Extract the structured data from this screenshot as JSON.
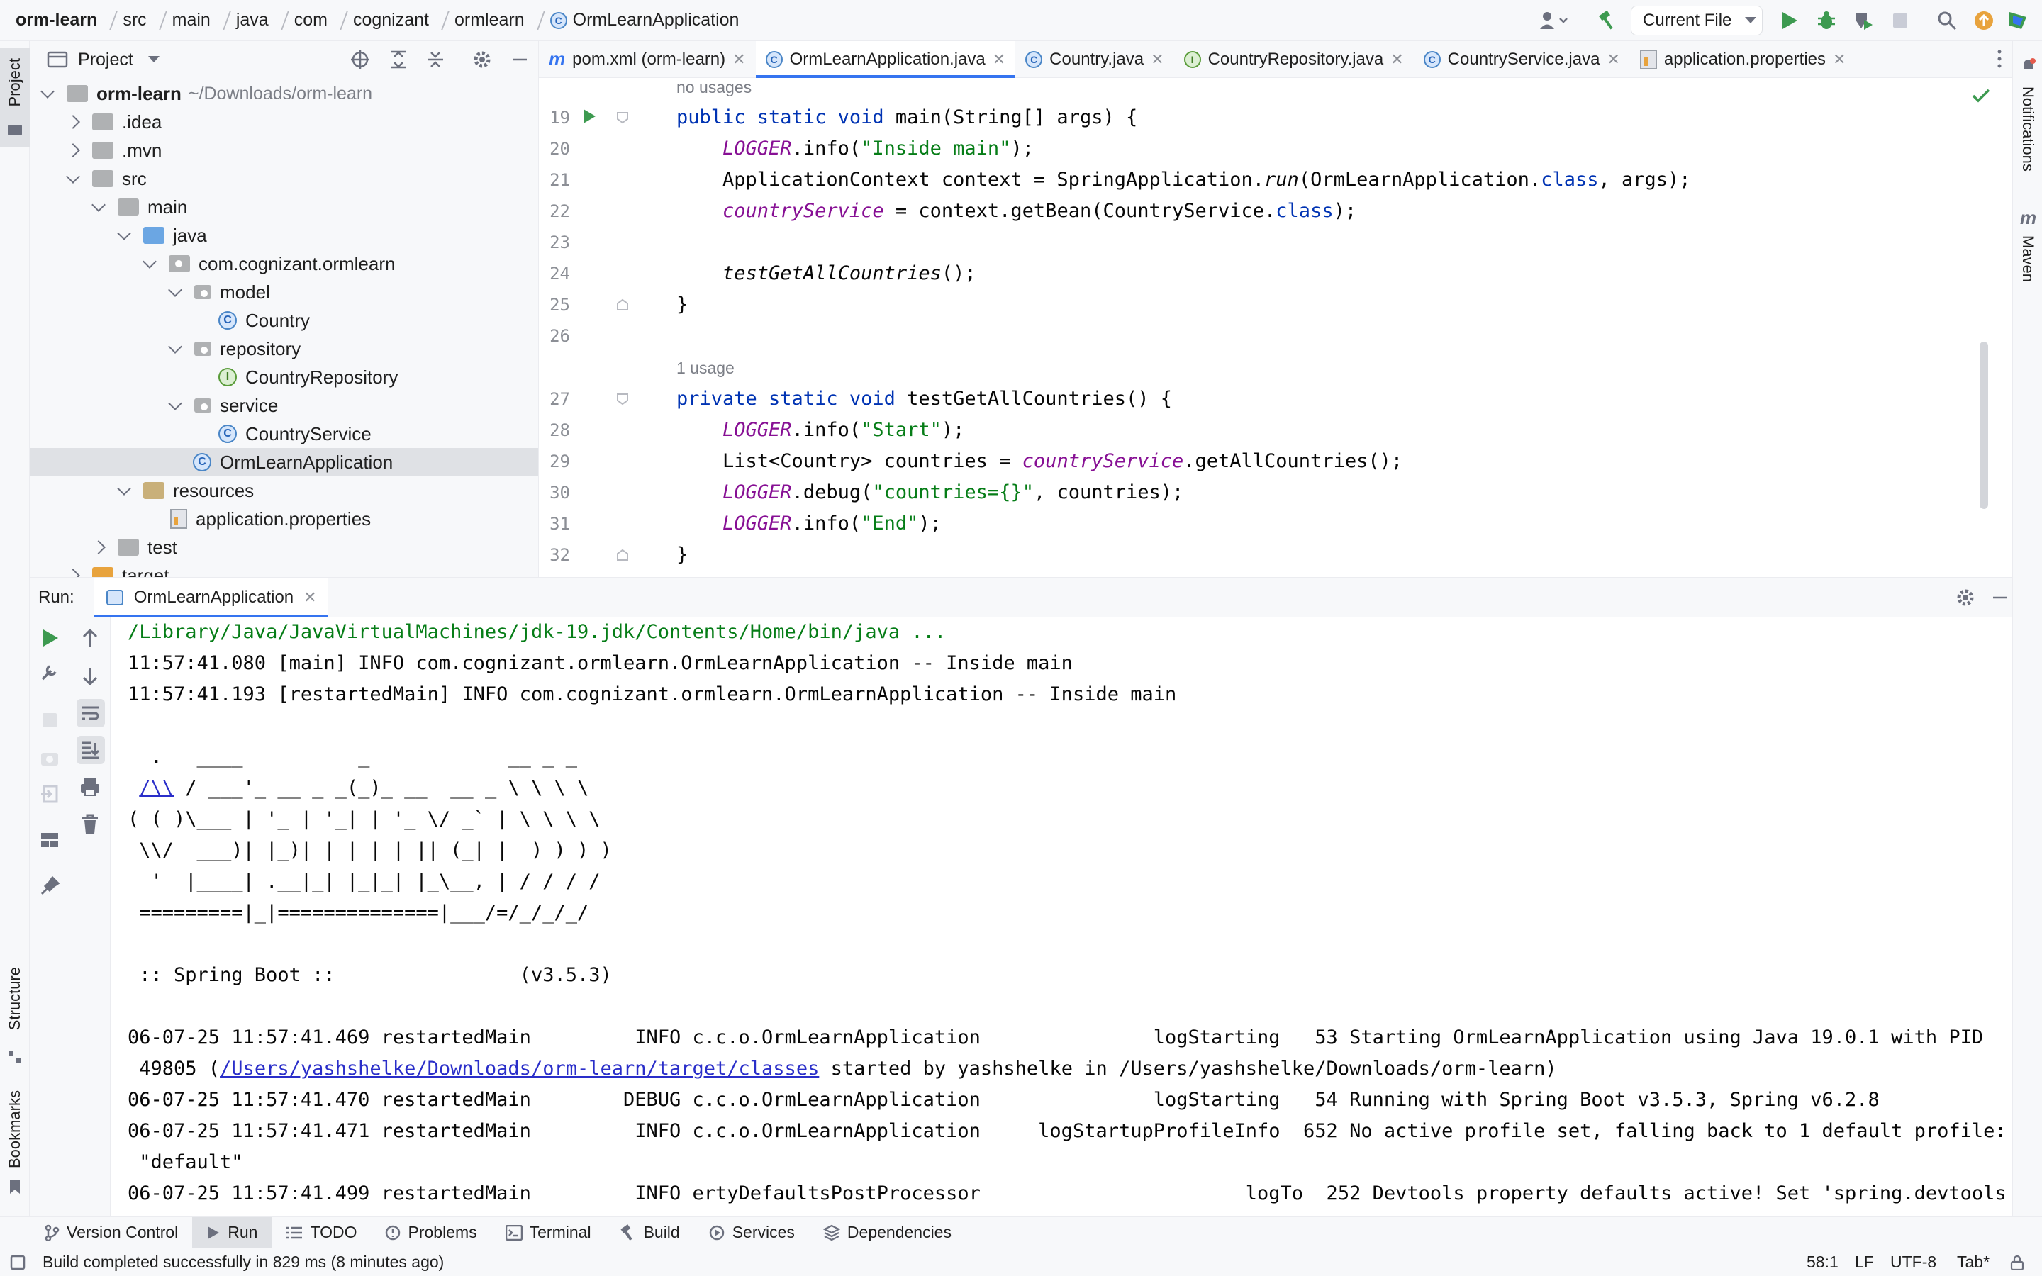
{
  "breadcrumb": [
    "orm-learn",
    "src",
    "main",
    "java",
    "com",
    "cognizant",
    "ormlearn",
    "OrmLearnApplication"
  ],
  "toolbar": {
    "run_config": "Current File"
  },
  "left_strip": {
    "project": "Project",
    "structure": "Structure",
    "bookmarks": "Bookmarks"
  },
  "right_strip": {
    "notifications": "Notifications",
    "maven": "Maven"
  },
  "project_panel": {
    "title": "Project",
    "tree": [
      {
        "label": "orm-learn",
        "path": "~/Downloads/orm-learn"
      },
      {
        "label": ".idea"
      },
      {
        "label": ".mvn"
      },
      {
        "label": "src"
      },
      {
        "label": "main"
      },
      {
        "label": "java"
      },
      {
        "label": "com.cognizant.ormlearn"
      },
      {
        "label": "model"
      },
      {
        "label": "Country"
      },
      {
        "label": "repository"
      },
      {
        "label": "CountryRepository"
      },
      {
        "label": "service"
      },
      {
        "label": "CountryService"
      },
      {
        "label": "OrmLearnApplication"
      },
      {
        "label": "resources"
      },
      {
        "label": "application.properties"
      },
      {
        "label": "test"
      },
      {
        "label": "target"
      }
    ]
  },
  "tabs": [
    {
      "label": "pom.xml (orm-learn)",
      "icon": "m"
    },
    {
      "label": "OrmLearnApplication.java",
      "icon": "C"
    },
    {
      "label": "Country.java",
      "icon": "C"
    },
    {
      "label": "CountryRepository.java",
      "icon": "I"
    },
    {
      "label": "CountryService.java",
      "icon": "C"
    },
    {
      "label": "application.properties",
      "icon": "props"
    }
  ],
  "editor": {
    "hints": {
      "no_usages": "no usages",
      "one_usage": "1 usage"
    },
    "line_numbers": [
      "19",
      "20",
      "21",
      "22",
      "23",
      "24",
      "25",
      "26",
      "27",
      "28",
      "29",
      "30",
      "31",
      "32"
    ],
    "code": {
      "l19a": "public static void ",
      "l19b": "main(String[] args) {",
      "l20a": "    ",
      "l20b": "LOGGER",
      "l20c": ".info(",
      "l20d": "\"Inside main\"",
      "l20e": ");",
      "l21a": "    ApplicationContext context = SpringApplication.",
      "l21b": "run",
      "l21c": "(OrmLearnApplication.",
      "l21d": "class",
      "l21e": ", args);",
      "l22a": "    ",
      "l22b": "countryService",
      "l22c": " = context.getBean(CountryService.",
      "l22d": "class",
      "l22e": ");",
      "l24a": "    ",
      "l24b": "testGetAllCountries",
      "l24c": "();",
      "l25": "}",
      "l27a": "private static void ",
      "l27b": "testGetAllCountries() {",
      "l28a": "    ",
      "l28b": "LOGGER",
      "l28c": ".info(",
      "l28d": "\"Start\"",
      "l28e": ");",
      "l29a": "    List<Country> countries = ",
      "l29b": "countryService",
      "l29c": ".getAllCountries();",
      "l30a": "    ",
      "l30b": "LOGGER",
      "l30c": ".debug(",
      "l30d": "\"countries={}\"",
      "l30e": ", countries);",
      "l31a": "    ",
      "l31b": "LOGGER",
      "l31c": ".info(",
      "l31d": "\"End\"",
      "l31e": ");",
      "l32": "}"
    }
  },
  "run_panel": {
    "label": "Run:",
    "tab": "OrmLearnApplication",
    "console": {
      "l1": "/Library/Java/JavaVirtualMachines/jdk-19.jdk/Contents/Home/bin/java ...",
      "l2": "11:57:41.080 [main] INFO com.cognizant.ormlearn.OrmLearnApplication -- Inside main",
      "l3": "11:57:41.193 [restartedMain] INFO com.cognizant.ormlearn.OrmLearnApplication -- Inside main",
      "b1": "  .   ____          _            __ _ _",
      "b2a": " ",
      "b2b": "/\\\\",
      "b2c": " / ___'_ __ _ _(_)_ __  __ _ \\ \\ \\ \\",
      "b3": "( ( )\\___ | '_ | '_| | '_ \\/ _` | \\ \\ \\ \\",
      "b4": " \\\\/  ___)| |_)| | | | | || (_| |  ) ) ) )",
      "b5": "  '  |____| .__|_| |_|_| |_\\__, | / / / /",
      "b6": " =========|_|==============|___/=/_/_/_/",
      "boot": " :: Spring Boot ::                (v3.5.3)",
      "r1": "06-07-25 11:57:41.469 restartedMain         INFO c.c.o.OrmLearnApplication               logStarting   53 Starting OrmLearnApplication using Java 19.0.1 with PID",
      "r2a": " 49805 (",
      "r2b": "/Users/yashshelke/Downloads/orm-learn/target/classes",
      "r2c": " started by yashshelke in /Users/yashshelke/Downloads/orm-learn)",
      "r3": "06-07-25 11:57:41.470 restartedMain        DEBUG c.c.o.OrmLearnApplication               logStarting   54 Running with Spring Boot v3.5.3, Spring v6.2.8",
      "r4": "06-07-25 11:57:41.471 restartedMain         INFO c.c.o.OrmLearnApplication     logStartupProfileInfo  652 No active profile set, falling back to 1 default profile:",
      "r5": " \"default\"",
      "r6": "06-07-25 11:57:41.499 restartedMain         INFO ertyDefaultsPostProcessor                       logTo  252 Devtools property defaults active! Set 'spring.devtools"
    }
  },
  "tool_windows": [
    "Version Control",
    "Run",
    "TODO",
    "Problems",
    "Terminal",
    "Build",
    "Services",
    "Dependencies"
  ],
  "status": {
    "message": "Build completed successfully in 829 ms (8 minutes ago)",
    "position": "58:1",
    "line_sep": "LF",
    "encoding": "UTF-8",
    "indent": "Tab*"
  },
  "colors": {
    "accent": "#3574f0",
    "keyword": "#0033b3",
    "string": "#067d17",
    "field": "#871094",
    "run_green": "#3d9a50"
  }
}
